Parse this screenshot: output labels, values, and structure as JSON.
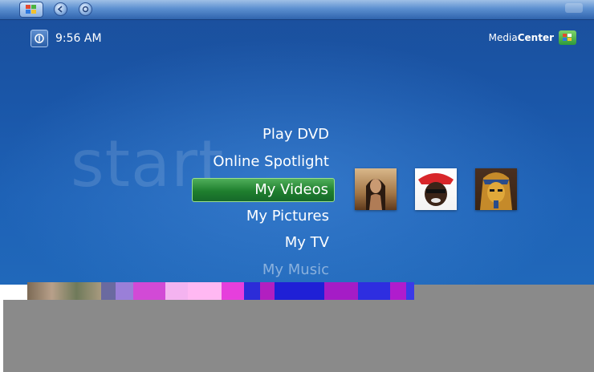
{
  "status": {
    "time": "9:56 AM"
  },
  "branding": {
    "media": "Media",
    "center": "Center"
  },
  "watermark": "start",
  "menu": {
    "items": [
      {
        "label": "Play DVD",
        "selected": false
      },
      {
        "label": "Online Spotlight",
        "selected": false
      },
      {
        "label": "My Videos",
        "selected": true
      },
      {
        "label": "My Pictures",
        "selected": false
      },
      {
        "label": "My TV",
        "selected": false
      },
      {
        "label": "My Music",
        "selected": false
      }
    ]
  },
  "thumbnails": [
    {
      "icon": "video-thumbnail-woman"
    },
    {
      "icon": "video-thumbnail-man-red-cap"
    },
    {
      "icon": "video-thumbnail-pharaoh-mask"
    }
  ],
  "colors": {
    "background": "#1b56a8",
    "selection": "#2a8a3a",
    "text": "#ffffff"
  }
}
